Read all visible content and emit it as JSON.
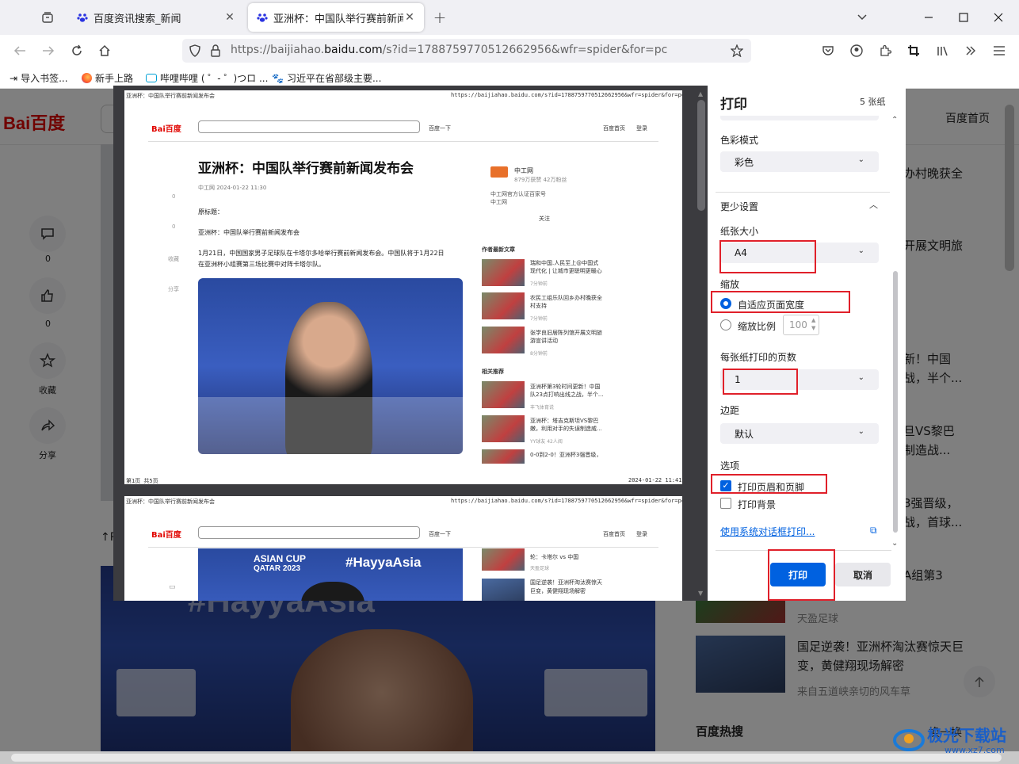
{
  "tabs": [
    {
      "title": "百度资讯搜索_新闻"
    },
    {
      "title": "亚洲杯：中国队举行赛前新闻发"
    }
  ],
  "url": {
    "prefix": "https://baijiahao.",
    "domain": "baidu.com",
    "suffix": "/s?id=1788759770512662956&wfr=spider&for=pc"
  },
  "bookmarks": [
    "导入书签...",
    "新手上路",
    "哔哩哔哩 ( ゜- ゜)つロ ...",
    "习近平在省部级主要..."
  ],
  "bgpage": {
    "logo": "Bai百度",
    "home": "百度首页",
    "side": [
      {
        "count": "0"
      },
      {
        "count": "0"
      },
      {
        "label": "收藏"
      },
      {
        "label": "分享"
      }
    ],
    "right_texts": [
      "办村晚获全",
      "开展文明旅",
      "新！中国",
      "战，半个...",
      "旦VS黎巴",
      "制造战...",
      "3强晋级，",
      "战，首球...",
      "A组第3"
    ],
    "news": [
      {
        "source": "天盈足球"
      },
      {
        "title": "国足逆袭！亚洲杯淘汰赛惊天巨变，黄健翔现场解密",
        "source": "来自五道峡亲切的风车草"
      }
    ],
    "hot": "百度热搜",
    "refresh": "换一换",
    "arrow": "↑P"
  },
  "preview": {
    "p1": {
      "header_left": "亚洲杯：中国队举行赛前新闻发布会",
      "header_right": "https://baijiahao.baidu.com/s?id=1788759770512662956&wfr=spider&for=pc",
      "search_btn": "百度一下",
      "nav_home": "百度首页",
      "nav_login": "登录",
      "title": "亚洲杯：中国队举行赛前新闻发布会",
      "meta": "中工网 2024-01-22 11:30",
      "l1": "原标题：",
      "l2": "亚洲杯：中国队举行赛前新闻发布会",
      "l3": "1月21日，中国国家男子足球队在卡塔尔多哈举行赛前新闻发布会。中国队将于1月22日",
      "l4": "在亚洲杯小组赛第三场比赛中对阵卡塔尔队。",
      "side_labels": [
        "0",
        "0",
        "收藏",
        "分享"
      ],
      "author": "中工网",
      "author_sub": "879万获赞 42万粉丝",
      "author_desc1": "中工网官方认证百家号",
      "author_desc2": "中工网",
      "follow": "关注",
      "sec1": "作者最新文章",
      "sec2": "相关推荐",
      "items": [
        {
          "t1": "瑞和中国.人民至上@中国式",
          "t2": "现代化 | 让城市更聪明更暖心",
          "s": "7分钟前"
        },
        {
          "t1": "农民工组乐队回乡办村晚获全",
          "t2": "村支持",
          "s": "7分钟前"
        },
        {
          "t1": "张学良旧居陈列馆开展文明旅",
          "t2": "游宣讲活动",
          "s": "8分钟前"
        },
        {
          "t1": "亚洲杯第3轮时间更新！中国",
          "t2": "队23点打响出线之战，半个...",
          "s": "丰飞体育说"
        },
        {
          "t1": "亚洲杯：塔吉克斯坦VS黎巴",
          "t2": "嫩，利用对手的失误制造威...",
          "s": "YY球友 42人阅"
        },
        {
          "t1": "0-0到2-0！亚洲杯3强晋级，",
          "t2": "",
          "s": ""
        }
      ],
      "footer_left": "第1页 共5页",
      "footer_right": "2024-01-22 11:41"
    },
    "p2": {
      "header_left": "亚洲杯：中国队举行赛前新闻发布会",
      "header_right": "https://baijiahao.baidu.com/s?id=1788759770512662956&wfr=spider&for=pc",
      "search_btn": "百度一下",
      "nav_home": "百度首页",
      "nav_login": "登录",
      "banner1": "ASIAN CUP",
      "banner2": "QATAR 2023",
      "banner3": "#HayyaAsia",
      "items": [
        {
          "t1": "轮：卡塔尔 vs 中国",
          "s": "天盈足球"
        },
        {
          "t1": "国足逆袭！亚洲杯淘汰赛惊天",
          "t2": "巨变，黄健翔现场解密"
        }
      ]
    }
  },
  "panel": {
    "title": "打印",
    "sheets": "5 张纸",
    "color_label": "色彩模式",
    "color_value": "彩色",
    "more": "更少设置",
    "paper_label": "纸张大小",
    "paper_value": "A4",
    "scale_label": "缩放",
    "fit": "自适应页面宽度",
    "scale_ratio": "缩放比例",
    "scale_value": "100",
    "pps_label": "每张纸打印的页数",
    "pps_value": "1",
    "margin_label": "边距",
    "margin_value": "默认",
    "options_label": "选项",
    "opt1": "打印页眉和页脚",
    "opt2": "打印背景",
    "system": "使用系统对话框打印...",
    "print": "打印",
    "cancel": "取消"
  },
  "watermark": {
    "name": "极光下载站",
    "url": "www.xz7.com"
  },
  "colors": {
    "accent": "#0061e0",
    "highlight": "#e0202a",
    "baidu_red": "#e10602",
    "baidu_blue": "#2932e1"
  }
}
